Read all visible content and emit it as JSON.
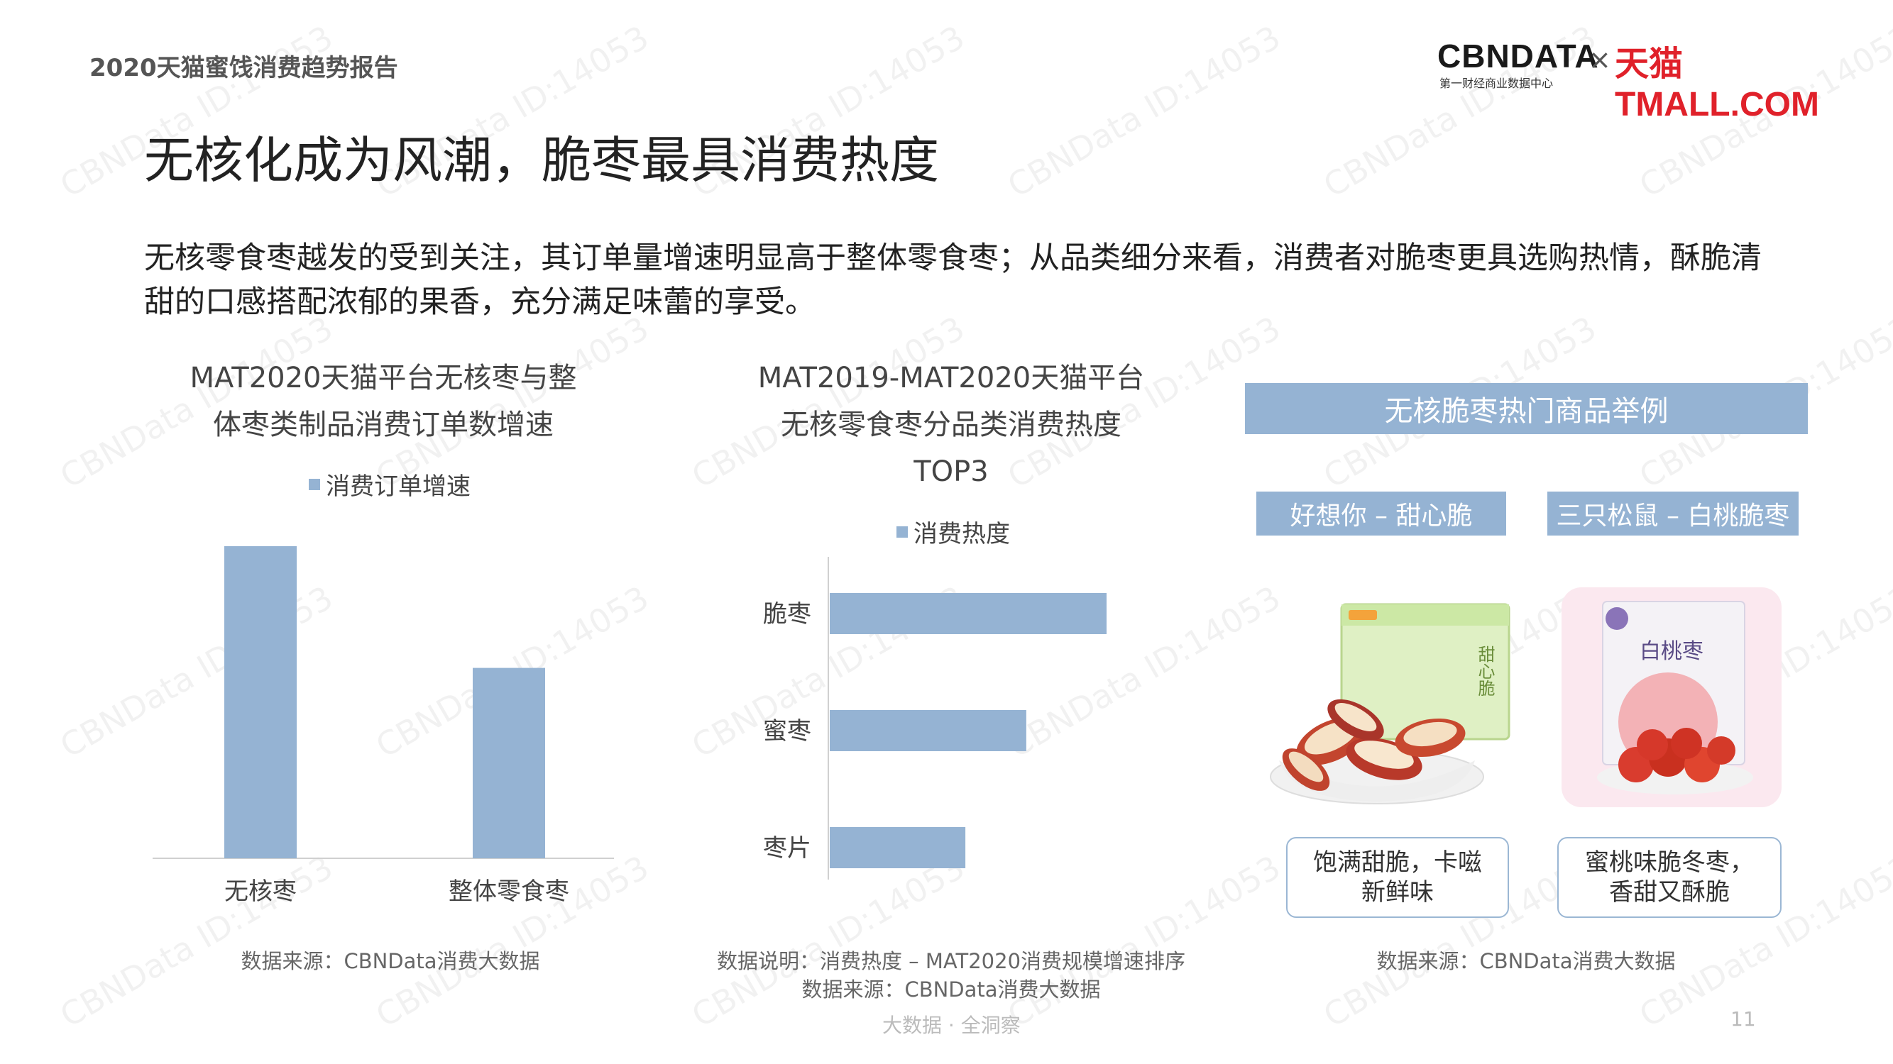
{
  "header": {
    "report_title": "2020天猫蜜饯消费趋势报告",
    "logo_cbn": "CBNDATA",
    "logo_cbn_sub": "第一财经商业数据中心",
    "logo_x": "×",
    "logo_tmall": "天猫 TMALL.COM"
  },
  "main_title": "无核化成为风潮，脆枣最具消费热度",
  "subtitle": "无核零食枣越发的受到关注，其订单量增速明显高于整体零食枣；从品类细分来看，消费者对脆枣更具选购热情，酥脆清甜的口感搭配浓郁的果香，充分满足味蕾的享受。",
  "left_chart": {
    "title_line1": "MAT2020天猫平台无核枣与整",
    "title_line2": "体枣类制品消费订单数增速",
    "source": "数据来源：CBNData消费大数据"
  },
  "middle_chart": {
    "title_line1": "MAT2019-MAT2020天猫平台",
    "title_line2": "无核零食枣分品类消费热度",
    "title_line3": "TOP3",
    "note": "数据说明：消费热度 – MAT2020消费规模增速排序",
    "source": "数据来源：CBNData消费大数据"
  },
  "chart_data": [
    {
      "type": "bar",
      "orientation": "vertical",
      "title": "MAT2020天猫平台无核枣与整体枣类制品消费订单数增速",
      "categories": [
        "无核枣",
        "整体零食枣"
      ],
      "series": [
        {
          "name": "消费订单增速",
          "values": [
            100,
            61
          ]
        }
      ],
      "ylim": [
        0,
        100
      ],
      "legend": "top",
      "grid": false,
      "color": "#95b3d3"
    },
    {
      "type": "bar",
      "orientation": "horizontal",
      "title": "MAT2019-MAT2020天猫平台无核零食枣分品类消费热度TOP3",
      "categories": [
        "脆枣",
        "蜜枣",
        "枣片"
      ],
      "series": [
        {
          "name": "消费热度",
          "values": [
            100,
            71,
            49
          ]
        }
      ],
      "xlim": [
        0,
        100
      ],
      "legend": "top",
      "grid": false,
      "color": "#95b3d3"
    }
  ],
  "right_panel": {
    "banner": "无核脆枣热门商品举例",
    "product1": {
      "name": "好想你 – 甜心脆",
      "caption_line1": "饱满甜脆，卡嗞",
      "caption_line2": "新鲜味",
      "pack_text": "甜心脆"
    },
    "product2": {
      "name": "三只松鼠 – 白桃脆枣",
      "caption_line1": "蜜桃味脆冬枣，",
      "caption_line2": "香甜又酥脆",
      "pack_text": "白桃枣"
    },
    "source": "数据来源：CBNData消费大数据"
  },
  "footer": {
    "tagline": "大数据 · 全洞察",
    "page": "11"
  },
  "watermark": "CBNData ID:14053",
  "colors": {
    "bar": "#95b3d3",
    "tmall_red": "#e0212a"
  }
}
